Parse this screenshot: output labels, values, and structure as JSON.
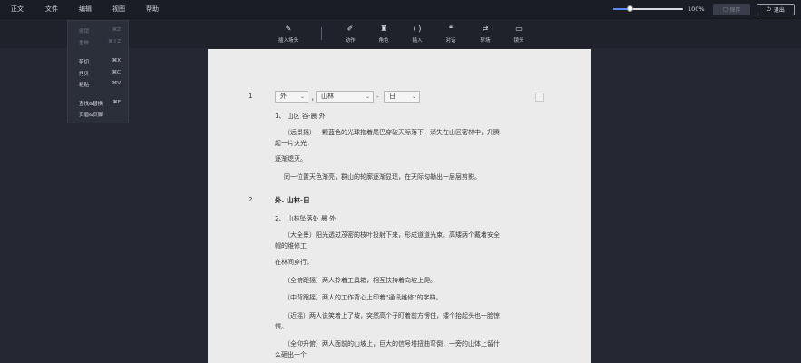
{
  "menubar": {
    "items": [
      "正文",
      "文件",
      "编辑",
      "视图",
      "帮助"
    ],
    "zoom_fraction": 0.24,
    "zoom_label": "100%",
    "save_label": "保存",
    "exit_label": "退出"
  },
  "toolbar": {
    "insert_scene": "插入场头",
    "action": "动作",
    "character": "角色",
    "insert": "插入",
    "dialogue": "对话",
    "transition": "转场",
    "shot": "镜头"
  },
  "edit_menu": {
    "items": [
      {
        "label": "撤销",
        "shortcut": "⌘Z",
        "enabled": false
      },
      {
        "label": "重做",
        "shortcut": "⌘⇧Z",
        "enabled": false
      },
      {
        "label": "剪切",
        "shortcut": "⌘X",
        "enabled": true
      },
      {
        "label": "拷贝",
        "shortcut": "⌘C",
        "enabled": true
      },
      {
        "label": "粘贴",
        "shortcut": "⌘V",
        "enabled": true
      },
      {
        "label": "查找&替换",
        "shortcut": "⌘F",
        "enabled": true
      },
      {
        "label": "页眉&页脚",
        "shortcut": "",
        "enabled": true
      }
    ]
  },
  "document": {
    "scene1": {
      "number": "1",
      "interior_exterior": "外",
      "location": "山林",
      "time": "日",
      "dot": "，",
      "dash": "-",
      "slug": "1、  山区  谷-晨  外",
      "lines": [
        "（远景摇）一颗蓝色的光球拖着尾巴穿破天际落下，消失在山区密林中，升腾",
        "起一片火光，",
        "逐渐熄灭。",
        "同一位置天色渐亮，群山的轮廓逐渐显现，在天际勾勒出一层层剪影。"
      ]
    },
    "scene2": {
      "number": "2",
      "heading": "外. 山林-日",
      "slug": "2、  山林坠落处  晨  外",
      "lines": [
        "（大全景）阳光透过茂密的枝叶投射下来，形成道道光束。高矮两个戴着安全",
        "帽的维修工",
        "在林间穿行。",
        "（全俯跟摇）两人拎着工具箱，相互扶持着向坡上爬。",
        "（中背跟摇）两人的工作背心上印着\"通讯维修\"的字样。",
        "（近摇）两人说笑着上了坡，突然高个子盯着前方愣住，矮个抬起头也一脸惊",
        "愕。",
        "（全仰升俯）两人面前的山坡上，巨大的信号塔扭曲弯倒，一旁的山体上留什",
        "么砸出一个"
      ]
    }
  }
}
